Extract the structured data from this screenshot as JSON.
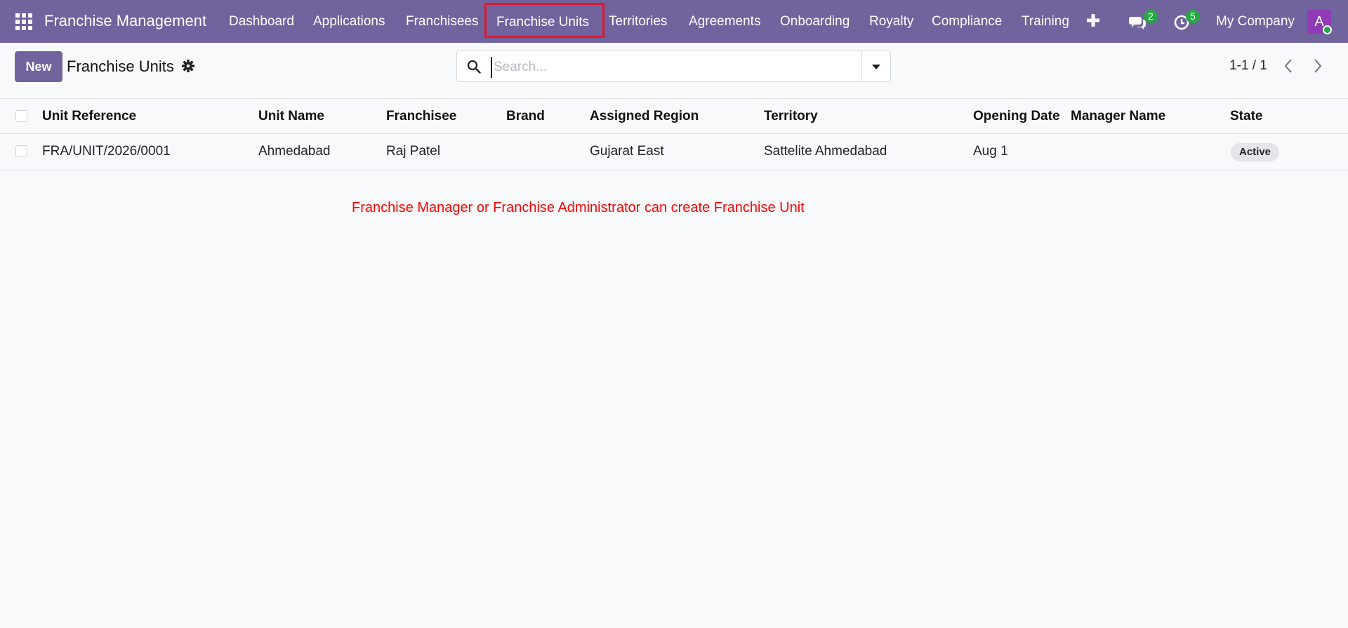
{
  "navbar": {
    "brand": "Franchise Management",
    "menu": [
      {
        "id": "dashboard",
        "label": "Dashboard"
      },
      {
        "id": "applications",
        "label": "Applications"
      },
      {
        "id": "franchisees",
        "label": "Franchisees"
      },
      {
        "id": "franchise-units",
        "label": "Franchise Units"
      },
      {
        "id": "territories",
        "label": "Territories"
      },
      {
        "id": "agreements",
        "label": "Agreements"
      },
      {
        "id": "onboarding",
        "label": "Onboarding"
      },
      {
        "id": "royalty",
        "label": "Royalty"
      },
      {
        "id": "compliance",
        "label": "Compliance"
      },
      {
        "id": "training",
        "label": "Training"
      }
    ],
    "messages_count": "2",
    "activities_count": "5",
    "company": "My Company",
    "avatar_letter": "A",
    "accent_color": "#71639e",
    "highlight_color": "#e0182a"
  },
  "control_panel": {
    "new_label": "New",
    "title": "Franchise Units",
    "search_placeholder": "Search...",
    "pager": "1-1 / 1"
  },
  "table": {
    "columns": [
      "Unit Reference",
      "Unit Name",
      "Franchisee",
      "Brand",
      "Assigned Region",
      "Territory",
      "Opening Date",
      "Manager Name",
      "State"
    ],
    "rows": [
      {
        "unit_reference": "FRA/UNIT/2026/0001",
        "unit_name": "Ahmedabad",
        "franchisee": "Raj Patel",
        "brand": "",
        "assigned_region": "Gujarat East",
        "territory": "Sattelite Ahmedabad",
        "opening_date": "Aug 1",
        "manager_name": "",
        "state": "Active"
      }
    ]
  },
  "annotation": "Franchise Manager or Franchise Administrator can create Franchise Unit",
  "icons": [
    "apps-grid-icon",
    "plus-icon",
    "chat-icon",
    "clock-icon",
    "gear-icon",
    "search-icon",
    "chevron-down-icon",
    "chevron-left-icon",
    "chevron-right-icon"
  ]
}
